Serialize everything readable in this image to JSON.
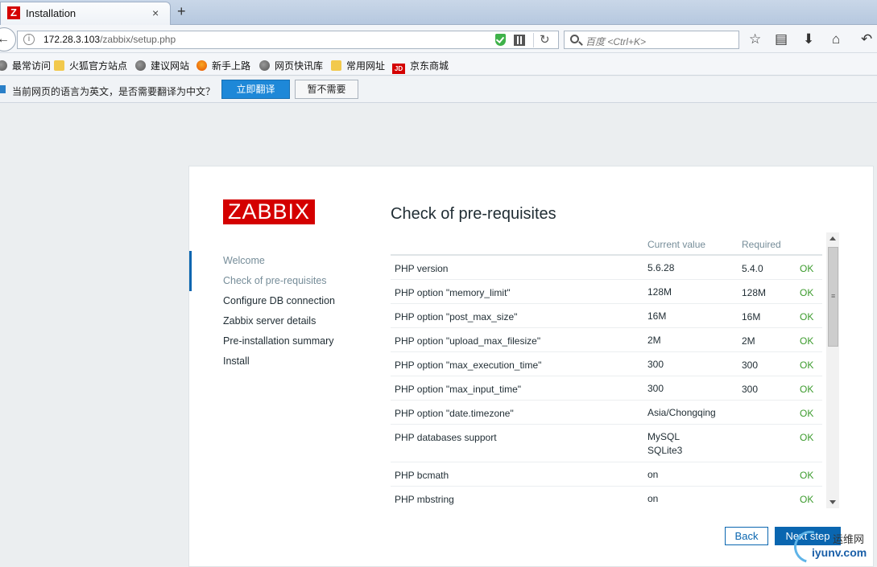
{
  "browser": {
    "tab": {
      "icon_letter": "Z",
      "title": "Installation",
      "close": "×"
    },
    "new_tab": "+",
    "url": {
      "host": "172.28.3.103",
      "path": "/zabbix/setup.php"
    },
    "search_placeholder": "百度 <Ctrl+K>",
    "bookmarks": [
      {
        "label": "最常访问",
        "icon": "gear-icon"
      },
      {
        "label": "火狐官方站点",
        "icon": "folder-icon"
      },
      {
        "label": "建议网站",
        "icon": "globe-icon"
      },
      {
        "label": "新手上路",
        "icon": "firefox-icon"
      },
      {
        "label": "网页快讯库",
        "icon": "globe-icon"
      },
      {
        "label": "常用网址",
        "icon": "folder-icon"
      },
      {
        "label": "京东商城",
        "icon": "jd-icon"
      }
    ],
    "translate_bar": {
      "message": "当前网页的语言为英文，是否需要翻译为中文？",
      "translate_button": "立即翻译",
      "decline_button": "暂不需要"
    }
  },
  "setup": {
    "logo": "ZABBIX",
    "title": "Check of pre-requisites",
    "steps": [
      {
        "label": "Welcome",
        "state": "done"
      },
      {
        "label": "Check of pre-requisites",
        "state": "current"
      },
      {
        "label": "Configure DB connection",
        "state": "pending"
      },
      {
        "label": "Zabbix server details",
        "state": "pending"
      },
      {
        "label": "Pre-installation summary",
        "state": "pending"
      },
      {
        "label": "Install",
        "state": "pending"
      }
    ],
    "columns": {
      "current": "Current value",
      "required": "Required"
    },
    "rows": [
      {
        "name": "PHP version",
        "current": "5.6.28",
        "required": "5.4.0",
        "status": "OK"
      },
      {
        "name": "PHP option \"memory_limit\"",
        "current": "128M",
        "required": "128M",
        "status": "OK"
      },
      {
        "name": "PHP option \"post_max_size\"",
        "current": "16M",
        "required": "16M",
        "status": "OK"
      },
      {
        "name": "PHP option \"upload_max_filesize\"",
        "current": "2M",
        "required": "2M",
        "status": "OK"
      },
      {
        "name": "PHP option \"max_execution_time\"",
        "current": "300",
        "required": "300",
        "status": "OK"
      },
      {
        "name": "PHP option \"max_input_time\"",
        "current": "300",
        "required": "300",
        "status": "OK"
      },
      {
        "name": "PHP option \"date.timezone\"",
        "current": "Asia/Chongqing",
        "required": "",
        "status": "OK"
      },
      {
        "name": "PHP databases support",
        "current": "MySQL\nSQLite3",
        "required": "",
        "status": "OK"
      },
      {
        "name": "PHP bcmath",
        "current": "on",
        "required": "",
        "status": "OK"
      },
      {
        "name": "PHP mbstring",
        "current": "on",
        "required": "",
        "status": "OK"
      }
    ],
    "back_button": "Back",
    "next_button": "Next step"
  },
  "watermark": {
    "text_cn": "运维网",
    "url": "iyunv.com"
  },
  "colors": {
    "brand": "#d40000",
    "accent": "#0a66b0",
    "ok": "#3b9b2c"
  }
}
